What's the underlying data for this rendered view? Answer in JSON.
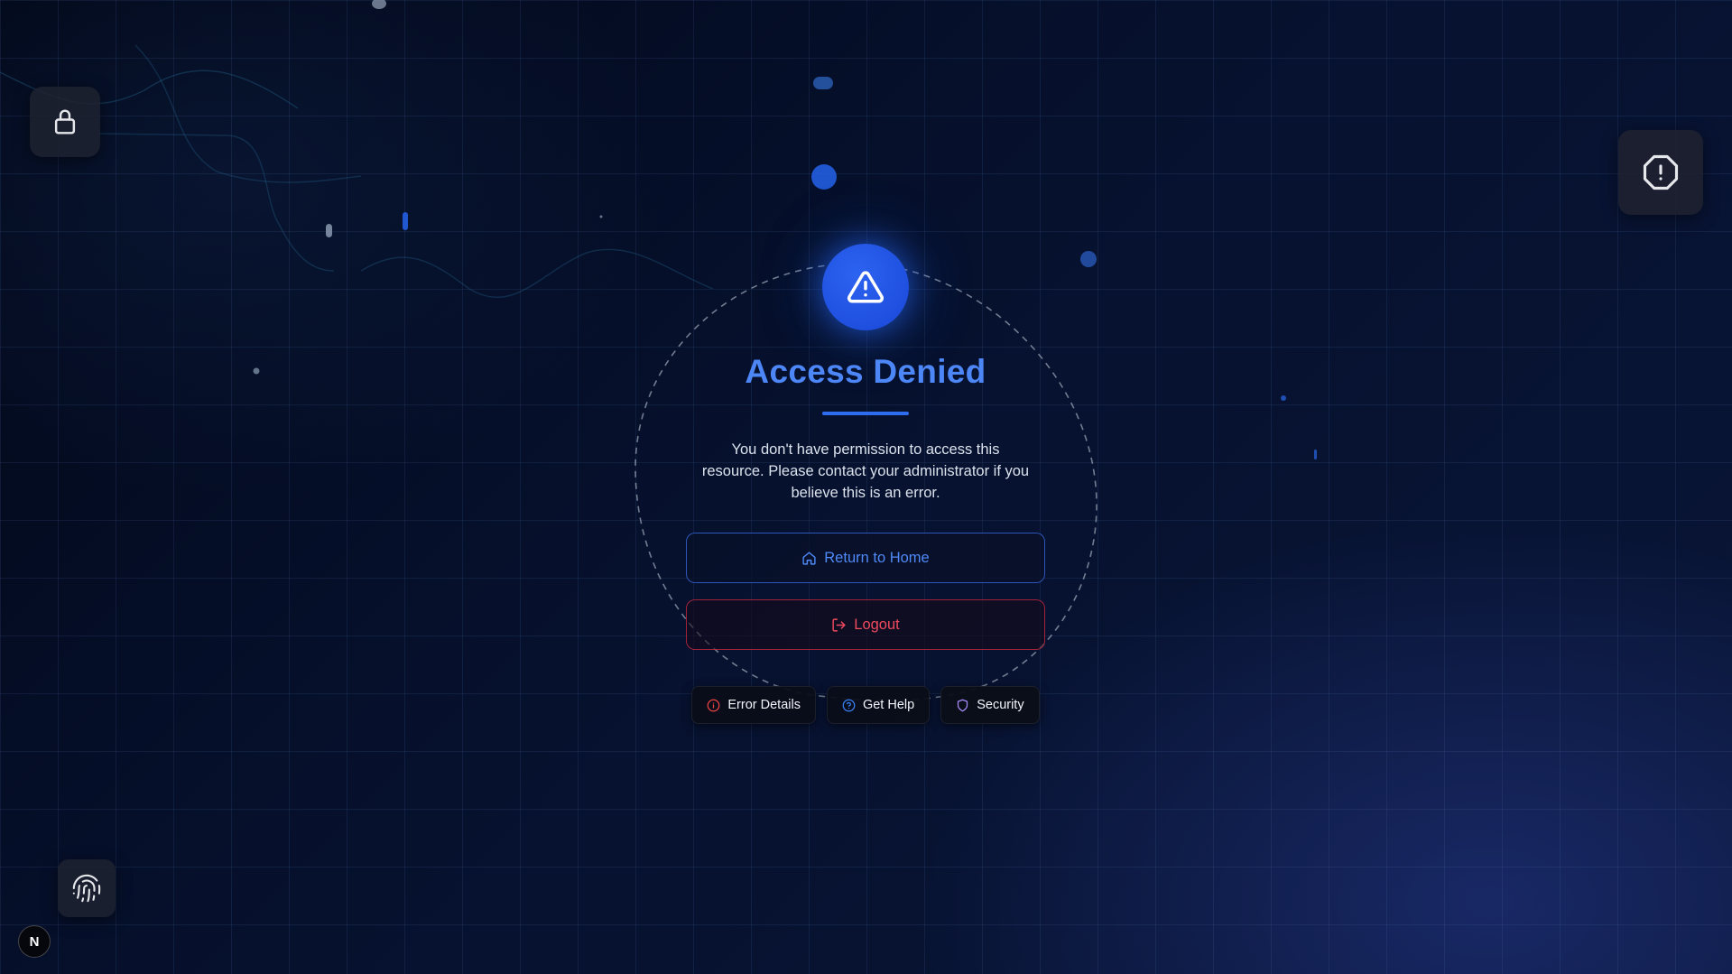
{
  "main": {
    "title": "Access Denied",
    "message": "You don't have permission to access this resource. Please contact your administrator if you believe this is an error.",
    "home_button_label": "Return to Home",
    "logout_button_label": "Logout"
  },
  "links": {
    "error_details_label": "Error Details",
    "get_help_label": "Get Help",
    "security_label": "Security"
  },
  "badge": {
    "letter": "N"
  },
  "icons": {
    "warning": "warning-triangle-icon",
    "lock": "lock-icon",
    "alert": "alert-octagon-icon",
    "fingerprint": "fingerprint-icon",
    "home": "home-icon",
    "logout": "logout-icon",
    "info": "info-icon",
    "help": "help-circle-icon",
    "shield": "shield-icon"
  },
  "colors": {
    "accent": "#2563eb",
    "title": "#4d86f7",
    "danger": "#f04a5e",
    "error_icon": "#ef4444",
    "help_icon": "#3b82f6",
    "security_icon": "#a78bfa"
  }
}
